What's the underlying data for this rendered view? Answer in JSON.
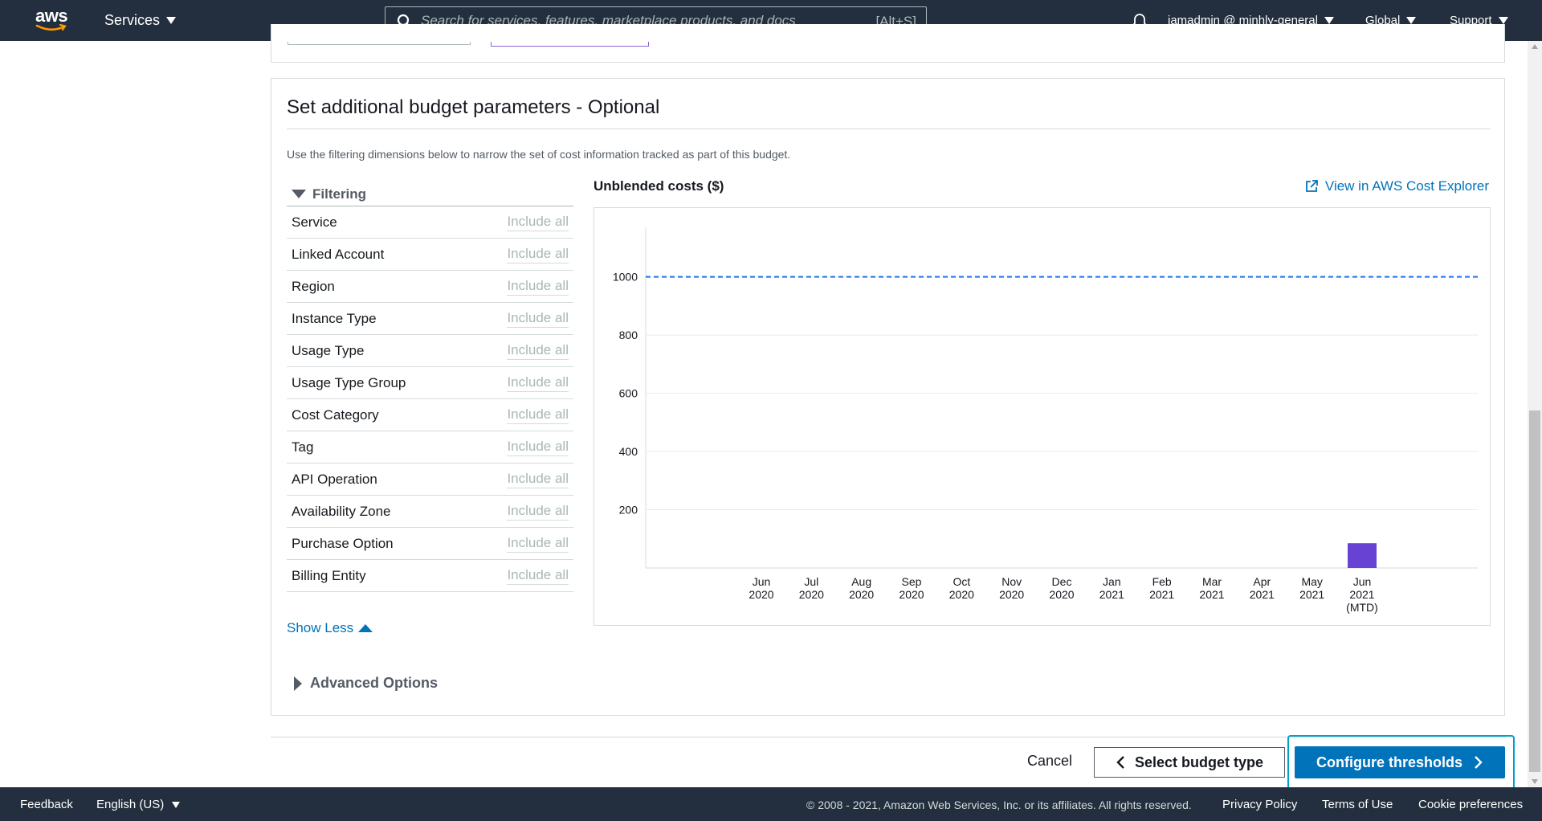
{
  "nav": {
    "logo_text": "aws",
    "services_label": "Services",
    "search_placeholder": "Search for services, features, marketplace products, and docs",
    "search_shortcut": "[Alt+S]",
    "account_label": "iamadmin @ minhly-general",
    "region_label": "Global",
    "support_label": "Support"
  },
  "section": {
    "title": "Set additional budget parameters - Optional",
    "description": "Use the filtering dimensions below to narrow the set of cost information tracked as part of this budget."
  },
  "filtering": {
    "header": "Filtering",
    "rows": [
      {
        "name": "Service",
        "value": "Include all"
      },
      {
        "name": "Linked Account",
        "value": "Include all"
      },
      {
        "name": "Region",
        "value": "Include all"
      },
      {
        "name": "Instance Type",
        "value": "Include all"
      },
      {
        "name": "Usage Type",
        "value": "Include all"
      },
      {
        "name": "Usage Type Group",
        "value": "Include all"
      },
      {
        "name": "Cost Category",
        "value": "Include all"
      },
      {
        "name": "Tag",
        "value": "Include all"
      },
      {
        "name": "API Operation",
        "value": "Include all"
      },
      {
        "name": "Availability Zone",
        "value": "Include all"
      },
      {
        "name": "Purchase Option",
        "value": "Include all"
      },
      {
        "name": "Billing Entity",
        "value": "Include all"
      }
    ],
    "show_less": "Show Less",
    "advanced_options": "Advanced Options"
  },
  "chart_header": {
    "title": "Unblended costs ($)",
    "explorer_link": "View in AWS Cost Explorer"
  },
  "chart_data": {
    "type": "bar",
    "title": "Unblended costs ($)",
    "categories": [
      [
        "Jun",
        "2020"
      ],
      [
        "Jul",
        "2020"
      ],
      [
        "Aug",
        "2020"
      ],
      [
        "Sep",
        "2020"
      ],
      [
        "Oct",
        "2020"
      ],
      [
        "Nov",
        "2020"
      ],
      [
        "Dec",
        "2020"
      ],
      [
        "Jan",
        "2021"
      ],
      [
        "Feb",
        "2021"
      ],
      [
        "Mar",
        "2021"
      ],
      [
        "Apr",
        "2021"
      ],
      [
        "May",
        "2021"
      ],
      [
        "Jun",
        "2021",
        "(MTD)"
      ]
    ],
    "values": [
      0,
      0,
      0,
      0,
      0,
      0,
      0,
      0,
      0,
      0,
      0,
      0,
      85
    ],
    "budget_line": 1000,
    "yticks": [
      200,
      400,
      600,
      800,
      1000
    ],
    "ylim": [
      0,
      1170
    ],
    "grid": true,
    "colors": {
      "bar": "#6842d2",
      "budget_line": "#1a73e8",
      "grid": "#e9ebed"
    }
  },
  "actions": {
    "cancel": "Cancel",
    "back": "Select budget type",
    "next": "Configure thresholds"
  },
  "footer": {
    "feedback": "Feedback",
    "language": "English (US)",
    "copyright": "© 2008 - 2021, Amazon Web Services, Inc. or its affiliates. All rights reserved.",
    "privacy": "Privacy Policy",
    "terms": "Terms of Use",
    "cookies": "Cookie preferences"
  }
}
